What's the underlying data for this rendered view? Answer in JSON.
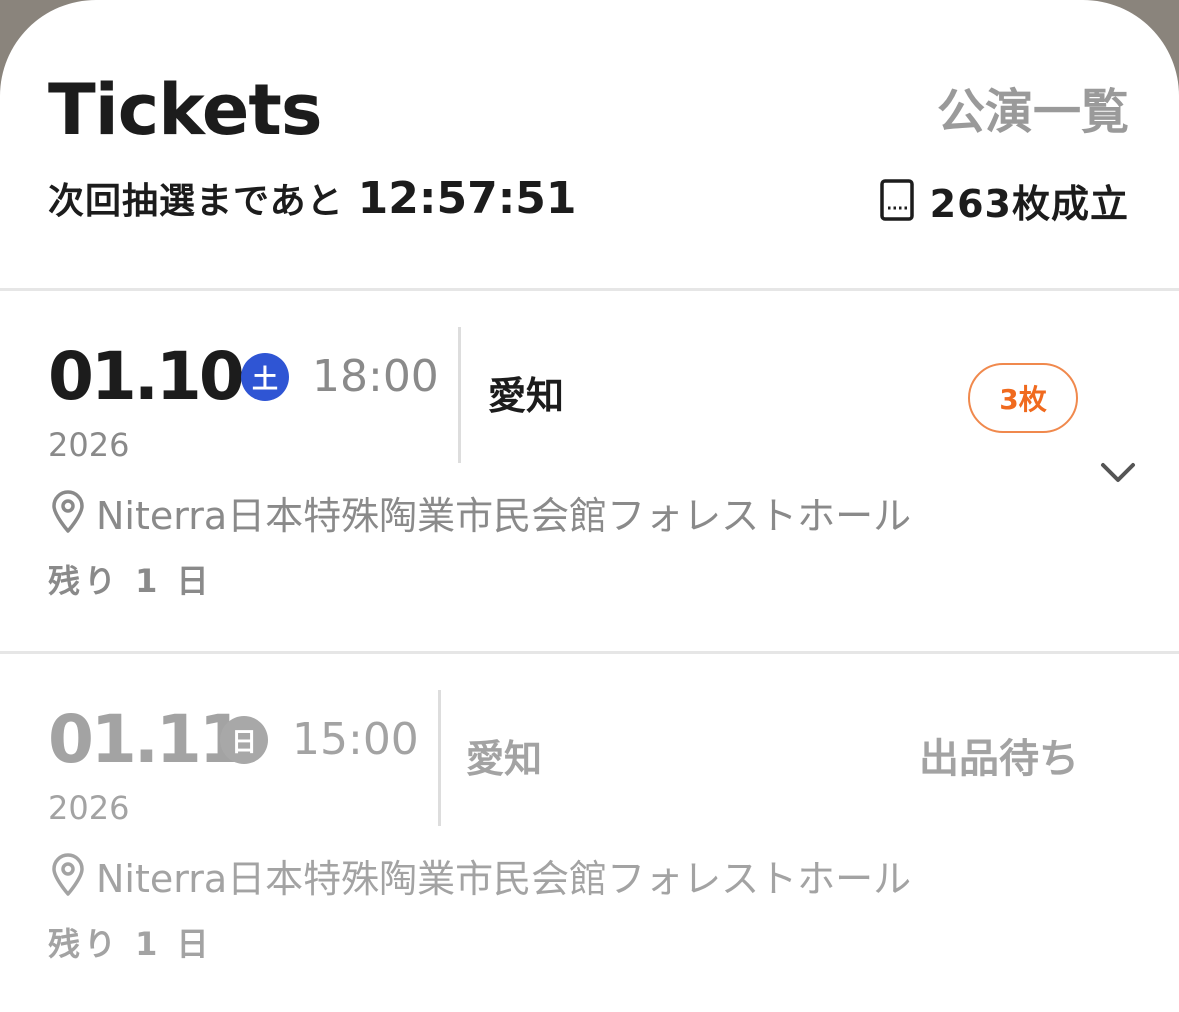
{
  "header": {
    "title": "Tickets",
    "performances_link": "公演一覧",
    "countdown_label": "次回抽選まであと",
    "countdown_time": "12:57:51",
    "deals_count": "263枚成立",
    "deals_icon": "ticket-icon"
  },
  "performances": [
    {
      "date": "01.10",
      "weekday": "土",
      "weekday_color": "#2f55d4",
      "time": "18:00",
      "year": "2026",
      "prefecture": "愛知",
      "ticket_badge": "3枚",
      "venue": "Niterra日本特殊陶業市民会館フォレストホール",
      "remaining": "残り 1 日",
      "expand_icon": "chevron-down-icon"
    },
    {
      "date": "01.11",
      "weekday": "日",
      "weekday_color": "#a8a8a8",
      "time": "15:00",
      "year": "2026",
      "prefecture": "愛知",
      "status": "出品待ち",
      "venue": "Niterra日本特殊陶業市民会館フォレストホール",
      "remaining": "残り 1 日"
    }
  ],
  "colors": {
    "accent_orange": "#f06a1e",
    "weekday_sat_blue": "#2f55d4",
    "muted_gray": "#a3a3a3"
  }
}
